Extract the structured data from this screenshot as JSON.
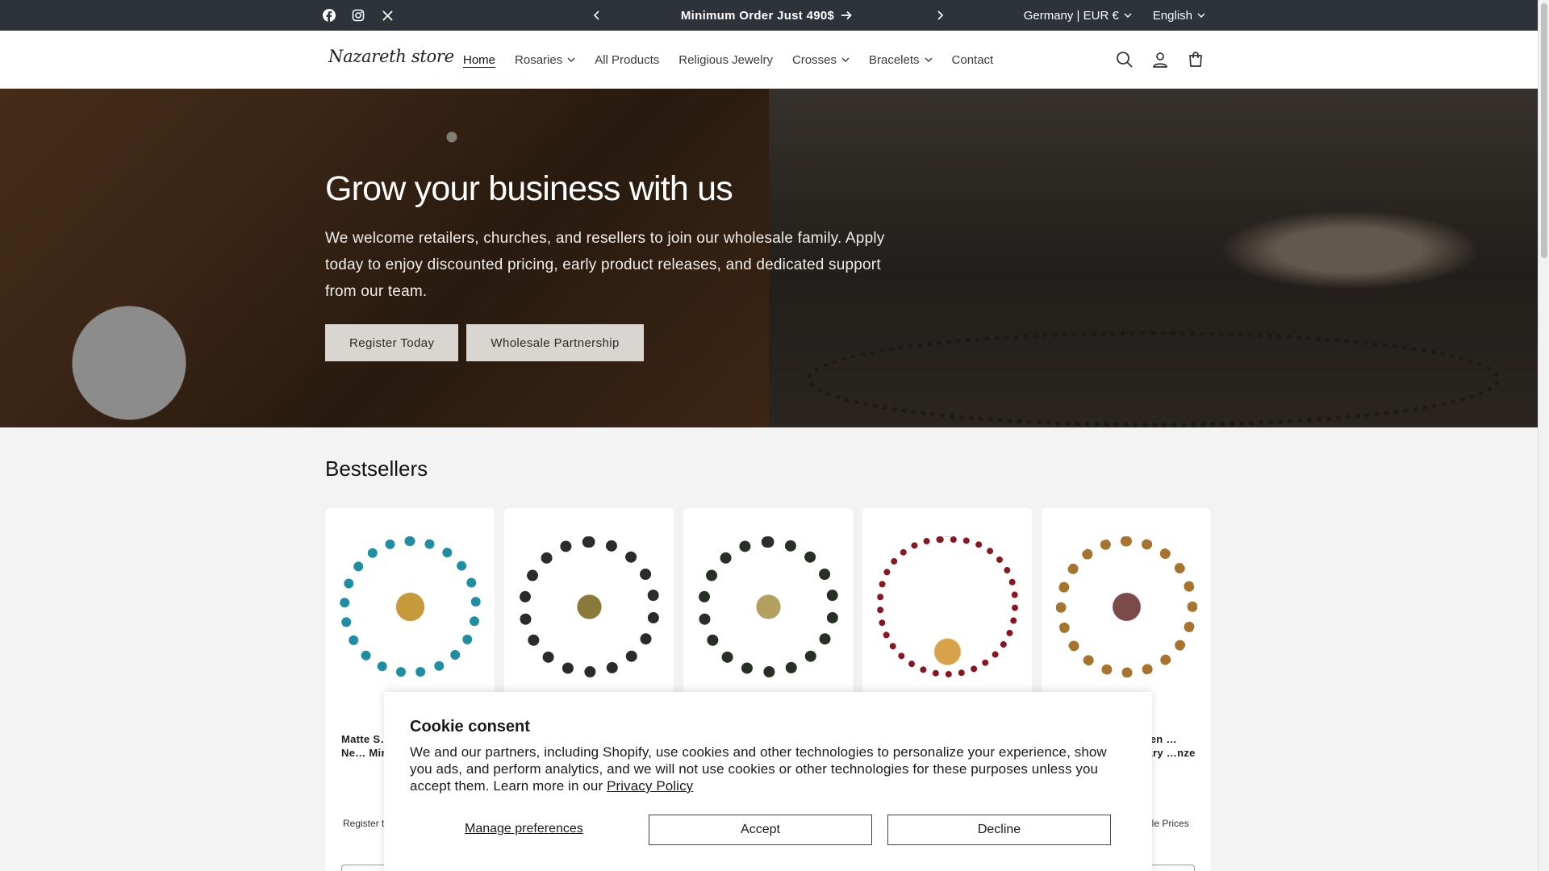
{
  "announcement": {
    "message": "Minimum Order Just 490$",
    "country": "Germany | EUR €",
    "language": "English",
    "social": [
      "facebook-icon",
      "instagram-icon",
      "x-icon"
    ]
  },
  "header": {
    "logo_text": "Nazareth store",
    "nav": [
      {
        "label": "Home",
        "active": true,
        "dropdown": false
      },
      {
        "label": "Rosaries",
        "active": false,
        "dropdown": true
      },
      {
        "label": "All Products",
        "active": false,
        "dropdown": false
      },
      {
        "label": "Religious Jewelry",
        "active": false,
        "dropdown": false
      },
      {
        "label": "Crosses",
        "active": false,
        "dropdown": true
      },
      {
        "label": "Bracelets",
        "active": false,
        "dropdown": true
      },
      {
        "label": "Contact",
        "active": false,
        "dropdown": false
      }
    ]
  },
  "hero": {
    "title": "Grow your business with us",
    "text": "We welcome retailers, churches, and resellers to join our wholesale family. Apply today to enjoy discounted pricing, early product releases, and dedicated support from our team.",
    "button_primary": "Register Today",
    "button_secondary": "Wholesale Partnership"
  },
  "bestsellers": {
    "heading": "Bestsellers",
    "products": [
      {
        "title": "Matte S… Round B… Gold Ne… Miraculo… Cross",
        "price": "Register t…",
        "colors": [
          "#1f8ea3",
          "#c49a3a"
        ]
      },
      {
        "title": "",
        "price": "",
        "colors": [
          "#2b2b2b",
          "#8a7a3a"
        ]
      },
      {
        "title": "",
        "price": "",
        "colors": [
          "#263024",
          "#b3a060"
        ]
      },
      {
        "title": "",
        "price": "",
        "colors": [
          "#8a1622",
          "#d8a24a"
        ]
      },
      {
        "title": "…oden …Rosary …nze St",
        "price": "…ale Prices",
        "colors": [
          "#a6742e",
          "#7a4b48"
        ]
      }
    ]
  },
  "cookie": {
    "title": "Cookie consent",
    "text": "We and our partners, including Shopify, use cookies and other technologies to personalize your experience, show you ads, and perform analytics, and we will not use cookies or other technologies for these purposes unless you accept them. Learn more in our",
    "policy_link": "Privacy Policy",
    "manage": "Manage preferences",
    "accept": "Accept",
    "decline": "Decline"
  }
}
